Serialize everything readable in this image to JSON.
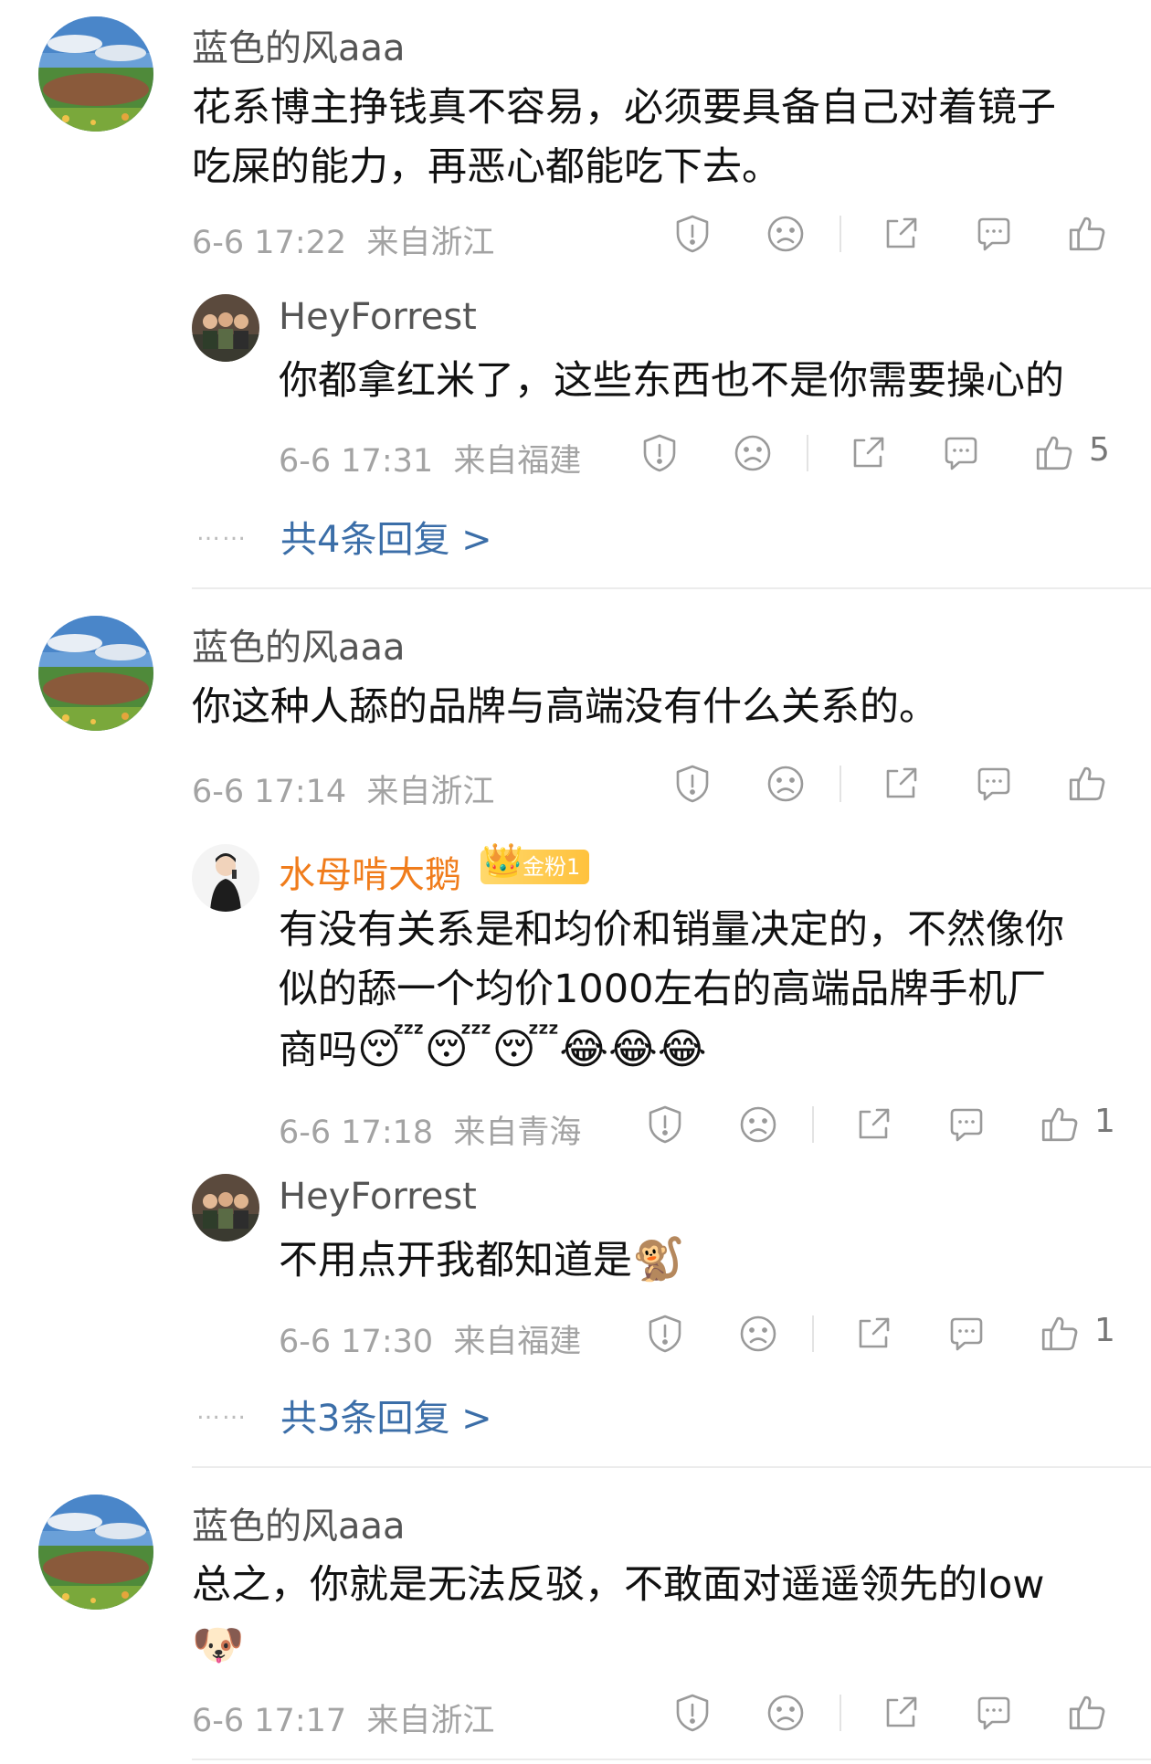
{
  "comments": [
    {
      "user": "蓝色的风aaa",
      "lines": [
        "花系博主挣钱真不容易，必须要具备自己对着镜子",
        "吃屎的能力，再恶心都能吃下去。"
      ],
      "time": "6-6 17:22",
      "location": "来自浙江",
      "replies": [
        {
          "user": "HeyForrest",
          "text": "你都拿红米了，这些东西也不是你需要操心的",
          "time": "6-6 17:31",
          "location": "来自福建",
          "likes": "5"
        }
      ],
      "more": "共4条回复 >"
    },
    {
      "user": "蓝色的风aaa",
      "lines": [
        "你这种人舔的品牌与高端没有什么关系的。"
      ],
      "time": "6-6 17:14",
      "location": "来自浙江",
      "replies": [
        {
          "user": "水母啃大鹅",
          "badge": "金粉1",
          "lines": [
            "有没有关系是和均价和销量决定的，不然像你",
            "似的舔一个均价1000左右的高端品牌手机厂",
            "商吗"
          ],
          "emojis": [
            "😴",
            "😴",
            "😴",
            "😂",
            "😂",
            "😂"
          ],
          "time": "6-6 17:18",
          "location": "来自青海",
          "likes": "1"
        },
        {
          "user": "HeyForrest",
          "text": "不用点开我都知道是",
          "emoji": "🐒",
          "time": "6-6 17:30",
          "location": "来自福建",
          "likes": "1"
        }
      ],
      "more": "共3条回复 >"
    },
    {
      "user": "蓝色的风aaa",
      "lines": [
        "总之，你就是无法反驳，不敢面对遥遥领先的low"
      ],
      "emoji": "🐶",
      "time": "6-6 17:17",
      "location": "来自浙江"
    }
  ],
  "more_dots": "……",
  "icons": [
    "report-icon",
    "dislike-face-icon",
    "share-icon",
    "comment-icon",
    "like-icon"
  ],
  "colors": {
    "link": "#3b6ea8",
    "vip_name": "#f07c1b",
    "meta": "#a3a3a3"
  }
}
